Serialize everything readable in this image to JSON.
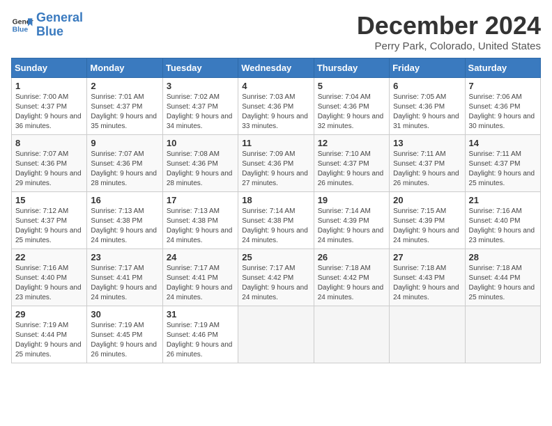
{
  "logo": {
    "line1": "General",
    "line2": "Blue"
  },
  "title": "December 2024",
  "location": "Perry Park, Colorado, United States",
  "weekdays": [
    "Sunday",
    "Monday",
    "Tuesday",
    "Wednesday",
    "Thursday",
    "Friday",
    "Saturday"
  ],
  "weeks": [
    [
      {
        "day": "1",
        "sunrise": "7:00 AM",
        "sunset": "4:37 PM",
        "daylight": "9 hours and 36 minutes."
      },
      {
        "day": "2",
        "sunrise": "7:01 AM",
        "sunset": "4:37 PM",
        "daylight": "9 hours and 35 minutes."
      },
      {
        "day": "3",
        "sunrise": "7:02 AM",
        "sunset": "4:37 PM",
        "daylight": "9 hours and 34 minutes."
      },
      {
        "day": "4",
        "sunrise": "7:03 AM",
        "sunset": "4:36 PM",
        "daylight": "9 hours and 33 minutes."
      },
      {
        "day": "5",
        "sunrise": "7:04 AM",
        "sunset": "4:36 PM",
        "daylight": "9 hours and 32 minutes."
      },
      {
        "day": "6",
        "sunrise": "7:05 AM",
        "sunset": "4:36 PM",
        "daylight": "9 hours and 31 minutes."
      },
      {
        "day": "7",
        "sunrise": "7:06 AM",
        "sunset": "4:36 PM",
        "daylight": "9 hours and 30 minutes."
      }
    ],
    [
      {
        "day": "8",
        "sunrise": "7:07 AM",
        "sunset": "4:36 PM",
        "daylight": "9 hours and 29 minutes."
      },
      {
        "day": "9",
        "sunrise": "7:07 AM",
        "sunset": "4:36 PM",
        "daylight": "9 hours and 28 minutes."
      },
      {
        "day": "10",
        "sunrise": "7:08 AM",
        "sunset": "4:36 PM",
        "daylight": "9 hours and 28 minutes."
      },
      {
        "day": "11",
        "sunrise": "7:09 AM",
        "sunset": "4:36 PM",
        "daylight": "9 hours and 27 minutes."
      },
      {
        "day": "12",
        "sunrise": "7:10 AM",
        "sunset": "4:37 PM",
        "daylight": "9 hours and 26 minutes."
      },
      {
        "day": "13",
        "sunrise": "7:11 AM",
        "sunset": "4:37 PM",
        "daylight": "9 hours and 26 minutes."
      },
      {
        "day": "14",
        "sunrise": "7:11 AM",
        "sunset": "4:37 PM",
        "daylight": "9 hours and 25 minutes."
      }
    ],
    [
      {
        "day": "15",
        "sunrise": "7:12 AM",
        "sunset": "4:37 PM",
        "daylight": "9 hours and 25 minutes."
      },
      {
        "day": "16",
        "sunrise": "7:13 AM",
        "sunset": "4:38 PM",
        "daylight": "9 hours and 24 minutes."
      },
      {
        "day": "17",
        "sunrise": "7:13 AM",
        "sunset": "4:38 PM",
        "daylight": "9 hours and 24 minutes."
      },
      {
        "day": "18",
        "sunrise": "7:14 AM",
        "sunset": "4:38 PM",
        "daylight": "9 hours and 24 minutes."
      },
      {
        "day": "19",
        "sunrise": "7:14 AM",
        "sunset": "4:39 PM",
        "daylight": "9 hours and 24 minutes."
      },
      {
        "day": "20",
        "sunrise": "7:15 AM",
        "sunset": "4:39 PM",
        "daylight": "9 hours and 24 minutes."
      },
      {
        "day": "21",
        "sunrise": "7:16 AM",
        "sunset": "4:40 PM",
        "daylight": "9 hours and 23 minutes."
      }
    ],
    [
      {
        "day": "22",
        "sunrise": "7:16 AM",
        "sunset": "4:40 PM",
        "daylight": "9 hours and 23 minutes."
      },
      {
        "day": "23",
        "sunrise": "7:17 AM",
        "sunset": "4:41 PM",
        "daylight": "9 hours and 24 minutes."
      },
      {
        "day": "24",
        "sunrise": "7:17 AM",
        "sunset": "4:41 PM",
        "daylight": "9 hours and 24 minutes."
      },
      {
        "day": "25",
        "sunrise": "7:17 AM",
        "sunset": "4:42 PM",
        "daylight": "9 hours and 24 minutes."
      },
      {
        "day": "26",
        "sunrise": "7:18 AM",
        "sunset": "4:42 PM",
        "daylight": "9 hours and 24 minutes."
      },
      {
        "day": "27",
        "sunrise": "7:18 AM",
        "sunset": "4:43 PM",
        "daylight": "9 hours and 24 minutes."
      },
      {
        "day": "28",
        "sunrise": "7:18 AM",
        "sunset": "4:44 PM",
        "daylight": "9 hours and 25 minutes."
      }
    ],
    [
      {
        "day": "29",
        "sunrise": "7:19 AM",
        "sunset": "4:44 PM",
        "daylight": "9 hours and 25 minutes."
      },
      {
        "day": "30",
        "sunrise": "7:19 AM",
        "sunset": "4:45 PM",
        "daylight": "9 hours and 26 minutes."
      },
      {
        "day": "31",
        "sunrise": "7:19 AM",
        "sunset": "4:46 PM",
        "daylight": "9 hours and 26 minutes."
      },
      null,
      null,
      null,
      null
    ]
  ]
}
